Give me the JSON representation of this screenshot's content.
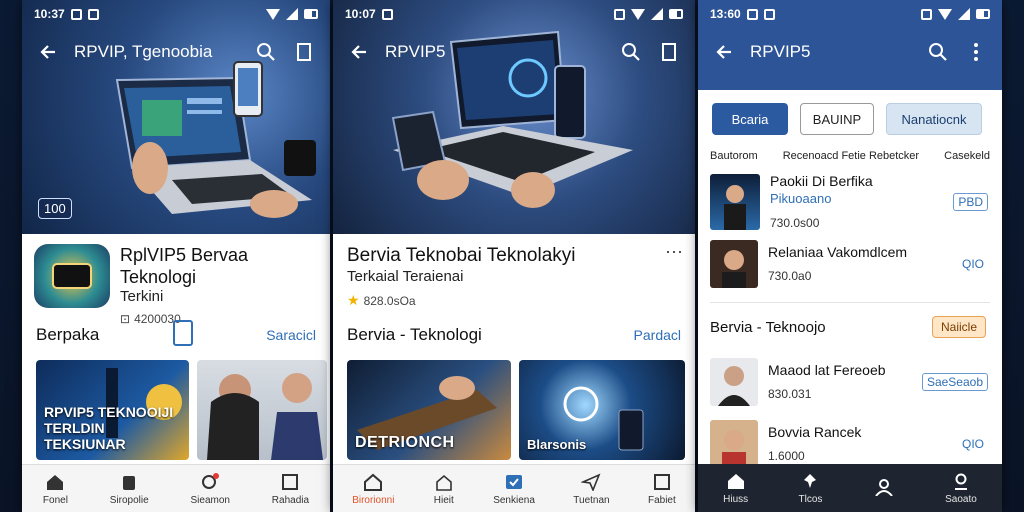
{
  "phone1": {
    "status": {
      "time": "10:37"
    },
    "appbar": {
      "title": "RPVIP, Tgenoobia"
    },
    "hero_badge": "100",
    "app": {
      "title": "RplVIP5 Bervaa Teknologi",
      "subtitle": "Terkini",
      "meta": "4200030"
    },
    "section": {
      "title": "Berpaka",
      "link": "Saracicl"
    },
    "cards": [
      {
        "text": "RPVIP5 TEKNOOIJI TERLDIN TEKSIUNAR"
      },
      {
        "text": ""
      }
    ],
    "nav": [
      "Fonel",
      "Siropolie",
      "Sieamon",
      "Rahadia"
    ]
  },
  "phone2": {
    "status": {
      "time": "10:07"
    },
    "appbar": {
      "title": "RPVIP5"
    },
    "app": {
      "title": "Bervia Teknobai Teknolakyi",
      "subtitle": "Terkaial Teraienai",
      "meta": "828.0sOa"
    },
    "section": {
      "title": "Bervia - Teknologi",
      "link": "Pardacl"
    },
    "cards": [
      {
        "text": "DETRIONCH"
      },
      {
        "text": "Blarsonis"
      }
    ],
    "nav": [
      "Birorionni",
      "Hieit",
      "Senkiena",
      "Tuetnan",
      "Fabiet"
    ]
  },
  "phone3": {
    "status": {
      "time": "13:60"
    },
    "appbar": {
      "title": "RPVIP5"
    },
    "chips": [
      "Bcaria",
      "BAUINP",
      "Nanatiocnk"
    ],
    "list_head": {
      "left": "Bautorom",
      "title": "Recenoacd Fetie Rebetcker",
      "right": "Casekeld"
    },
    "items": [
      {
        "title": "Paokii Di Berfika",
        "subtitle": "Pikuoaano",
        "meta": "730.0s00",
        "tag": "PBD"
      },
      {
        "title": "Relaniaa Vakomdlcem",
        "meta": "730.0a0",
        "tag": "QIO"
      },
      {
        "title": "Maaod lat Fereoeb",
        "meta": "830.031",
        "tag": "SaeSeaob"
      },
      {
        "title": "Bovvia Rancek",
        "meta": "1.6000",
        "tag": "QIO"
      }
    ],
    "section": {
      "title": "Bervia - Teknoojo",
      "tag": "Naiicle"
    },
    "nav": [
      "Hiuss",
      "Tlcos",
      "",
      "Saoato"
    ]
  }
}
